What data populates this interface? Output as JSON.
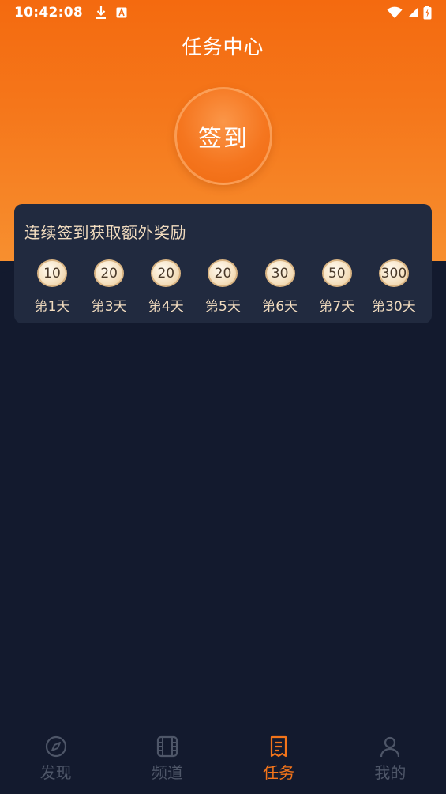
{
  "status_bar": {
    "time": "10:42:08"
  },
  "header": {
    "title": "任务中心"
  },
  "signin": {
    "label": "签到"
  },
  "reward_card": {
    "title": "连续签到获取额外奖励",
    "items": [
      {
        "points": "10",
        "day": "第1天"
      },
      {
        "points": "20",
        "day": "第3天"
      },
      {
        "points": "20",
        "day": "第4天"
      },
      {
        "points": "20",
        "day": "第5天"
      },
      {
        "points": "30",
        "day": "第6天"
      },
      {
        "points": "50",
        "day": "第7天"
      },
      {
        "points": "300",
        "day": "第30天"
      }
    ]
  },
  "bottom_nav": {
    "items": [
      {
        "label": "发现",
        "icon": "compass-icon"
      },
      {
        "label": "频道",
        "icon": "film-icon"
      },
      {
        "label": "任务",
        "icon": "task-list-icon"
      },
      {
        "label": "我的",
        "icon": "user-icon"
      }
    ],
    "active_index": 2
  },
  "colors": {
    "accent": "#f3741a",
    "background": "#131a2e",
    "card": "#212a3f",
    "text_gold": "#f2dcbf"
  }
}
